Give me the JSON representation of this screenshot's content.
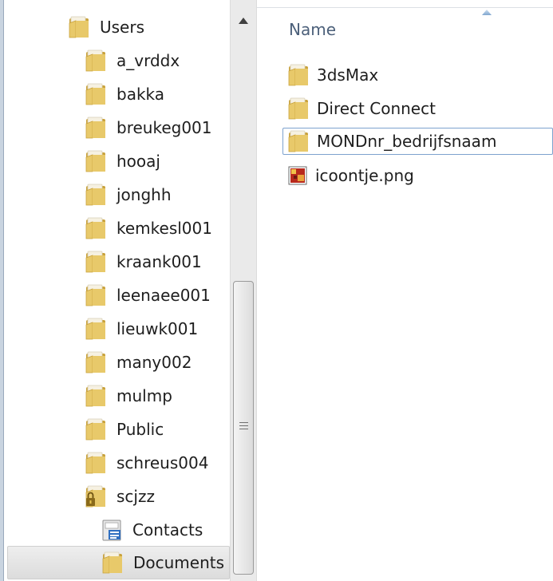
{
  "nav_tree": {
    "items": [
      {
        "label": "Users",
        "icon": "folder-icon",
        "indent": 0
      },
      {
        "label": "a_vrddx",
        "icon": "folder-icon",
        "indent": 1
      },
      {
        "label": "bakka",
        "icon": "folder-icon",
        "indent": 1
      },
      {
        "label": "breukeg001",
        "icon": "folder-icon",
        "indent": 1
      },
      {
        "label": "hooaj",
        "icon": "folder-icon",
        "indent": 1
      },
      {
        "label": "jonghh",
        "icon": "folder-icon",
        "indent": 1
      },
      {
        "label": "kemkesl001",
        "icon": "folder-icon",
        "indent": 1
      },
      {
        "label": "kraank001",
        "icon": "folder-icon",
        "indent": 1
      },
      {
        "label": "leenaee001",
        "icon": "folder-icon",
        "indent": 1
      },
      {
        "label": "lieuwk001",
        "icon": "folder-icon",
        "indent": 1
      },
      {
        "label": "many002",
        "icon": "folder-icon",
        "indent": 1
      },
      {
        "label": "mulmp",
        "icon": "folder-icon",
        "indent": 1
      },
      {
        "label": "Public",
        "icon": "folder-icon",
        "indent": 1
      },
      {
        "label": "schreus004",
        "icon": "folder-icon",
        "indent": 1
      },
      {
        "label": "scjzz",
        "icon": "locked-folder-icon",
        "indent": 1
      },
      {
        "label": "Contacts",
        "icon": "contacts-folder-icon",
        "indent": 2
      },
      {
        "label": "Documents",
        "icon": "folder-icon",
        "indent": 2,
        "selected": true
      }
    ]
  },
  "content": {
    "column_header": "Name",
    "files": [
      {
        "label": "3dsMax",
        "icon": "folder-icon"
      },
      {
        "label": "Direct Connect",
        "icon": "folder-icon"
      },
      {
        "label": "MONDnr_bedrijfsnaam",
        "icon": "folder-icon",
        "focused": true
      },
      {
        "label": "icoontje.png",
        "icon": "png-image-icon"
      }
    ]
  },
  "colors": {
    "folder": "#e8c96a",
    "folder_dark": "#c9a23c",
    "column_header_text": "#4c607a",
    "focus_border": "#7da2ce",
    "selection": "#dcdcdc"
  }
}
